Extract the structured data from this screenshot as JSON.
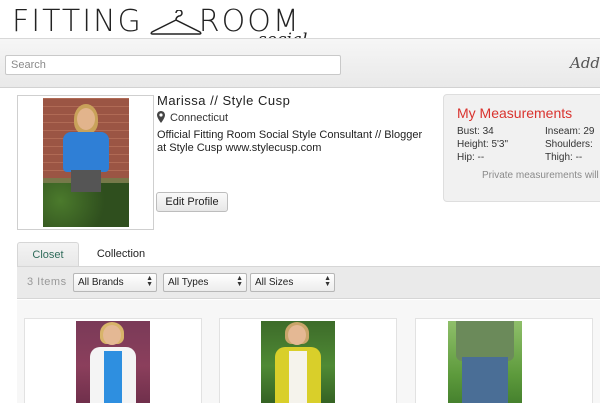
{
  "header": {
    "logo_word1": "FITTING",
    "logo_word2": "ROOM",
    "logo_sub": "social"
  },
  "search": {
    "placeholder": "Search",
    "value": ""
  },
  "add_link": "Add +",
  "profile": {
    "name": "Marissa // Style Cusp",
    "location": "Connecticut",
    "bio": "Official Fitting Room Social Style Consultant // Blogger at Style Cusp www.stylecusp.com",
    "edit_button": "Edit Profile"
  },
  "measurements": {
    "title": "My Measurements",
    "bust": "Bust: 34",
    "height": "Height: 5'3\"",
    "hip": "Hip: --",
    "inseam": "Inseam: 29",
    "shoulders": "Shoulders:",
    "thigh": "Thigh: --",
    "note": "Private measurements will c"
  },
  "tabs": [
    {
      "label": "Closet",
      "active": true
    },
    {
      "label": "Collection",
      "active": false
    }
  ],
  "filters": {
    "count": "3 Items",
    "brands": "All Brands",
    "types": "All Types",
    "sizes": "All Sizes"
  },
  "colors": {
    "accent_red": "#d9332e",
    "tab_active_text": "#2f6b5a"
  }
}
